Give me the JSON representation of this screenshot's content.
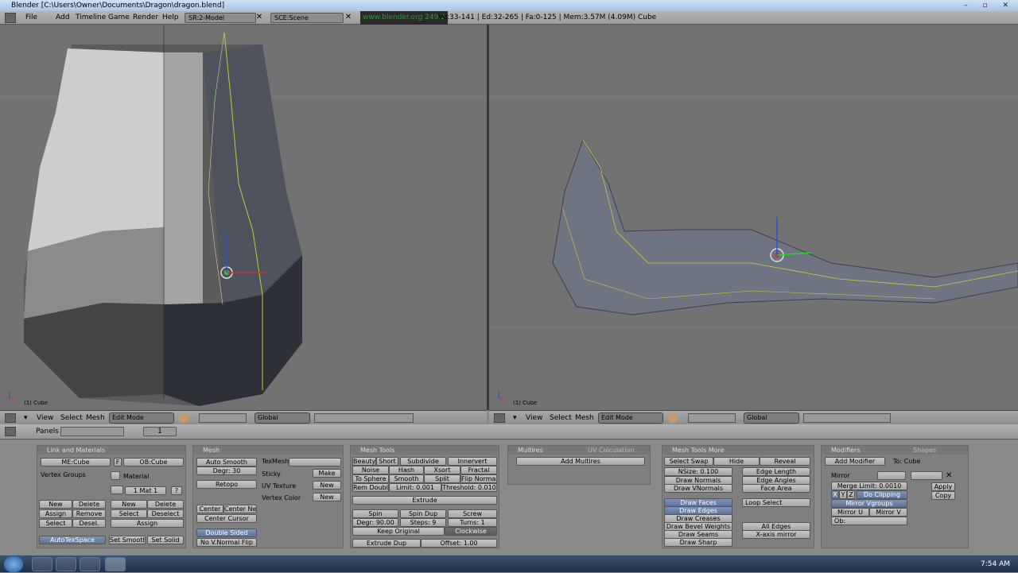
{
  "window": {
    "title": "Blender [C:\\Users\\Owner\\Documents\\Dragon\\dragon.blend]"
  },
  "menu": {
    "items": [
      "File",
      "Add",
      "Timeline",
      "Game",
      "Render",
      "Help"
    ],
    "screen": "SR:2-Model",
    "scene": "SCE:Scene",
    "url": "www.blender.org 249.2",
    "stats": "Ve:33-141 | Ed:32-265 | Fa:0-125 | Mem:3.57M (4.09M) Cube"
  },
  "viewport_left": {
    "label": "(1) Cube"
  },
  "viewport_right": {
    "label": "(1) Cube"
  },
  "header_left": {
    "view": "View",
    "select": "Select",
    "mesh": "Mesh",
    "mode": "Edit Mode",
    "orientation": "Global"
  },
  "header_right": {
    "view": "View",
    "select": "Select",
    "mesh": "Mesh",
    "mode": "Edit Mode",
    "orientation": "Global"
  },
  "buttons_header": {
    "panels": "Panels",
    "frame": "1"
  },
  "link_materials": {
    "title": "Link and Materials",
    "me": "ME:Cube",
    "f": "F",
    "ob": "OB:Cube",
    "vertex_groups": "Vertex Groups",
    "material": "Material",
    "mat": "1 Mat 1",
    "q": "?",
    "vg_new": "New",
    "vg_delete": "Delete",
    "vg_assign": "Assign",
    "vg_remove": "Remove",
    "vg_select": "Select",
    "vg_desel": "Desel.",
    "m_new": "New",
    "m_delete": "Delete",
    "m_select": "Select",
    "m_deselect": "Deselect",
    "m_assign": "Assign",
    "autotex": "AutoTexSpace",
    "set_smooth": "Set Smooth",
    "set_solid": "Set Solid"
  },
  "mesh": {
    "title": "Mesh",
    "auto_smooth": "Auto Smooth",
    "degr": "Degr: 30",
    "retopo": "Retopo",
    "texmesh": "TexMesh:",
    "sticky": "Sticky",
    "make": "Make",
    "uv_texture": "UV Texture",
    "new1": "New",
    "vertex_color": "Vertex Color",
    "new2": "New",
    "center": "Center",
    "center_new": "Center New",
    "center_cursor": "Center Cursor",
    "double_sided": "Double Sided",
    "no_v_normal_flip": "No V.Normal Flip"
  },
  "mesh_tools": {
    "title": "Mesh Tools",
    "beauty": "Beauty",
    "short": "Short",
    "subdivide": "Subdivide",
    "innervert": "Innervert",
    "noise": "Noise",
    "hash": "Hash",
    "xsort": "Xsort",
    "fractal": "Fractal",
    "to_sphere": "To Sphere",
    "smooth": "Smooth",
    "split": "Split",
    "flip_normal": "Flip Normal",
    "rem_doubl": "Rem Doubl",
    "limit": "Limit: 0.001",
    "threshold": "Threshold: 0.010",
    "extrude": "Extrude",
    "spin": "Spin",
    "spin_dup": "Spin Dup",
    "screw": "Screw",
    "degr": "Degr: 90.00",
    "steps": "Steps: 9",
    "turns": "Turns: 1",
    "keep_original": "Keep Original",
    "clockwise": "Clockwise",
    "extrude_dup": "Extrude Dup",
    "offset": "Offset: 1.00"
  },
  "multires": {
    "title": "Multires",
    "tab2": "UV Calculation",
    "add": "Add Multires"
  },
  "mesh_tools_more": {
    "title": "Mesh Tools More",
    "select_swap": "Select Swap",
    "hide": "Hide",
    "reveal": "Reveal",
    "nsize": "NSize: 0.100",
    "draw_normals": "Draw Normals",
    "draw_vnormals": "Draw VNormals",
    "edge_length": "Edge Length",
    "edge_angles": "Edge Angles",
    "face_area": "Face Area",
    "draw_faces": "Draw Faces",
    "draw_edges": "Draw Edges",
    "draw_creases": "Draw Creases",
    "draw_bevel": "Draw Bevel Weights",
    "draw_seams": "Draw Seams",
    "draw_sharp": "Draw Sharp",
    "loop_select": "Loop Select",
    "all_edges": "All Edges",
    "xaxis_mirror": "X-axis mirror"
  },
  "modifiers": {
    "title": "Modifiers",
    "tab2": "Shapes",
    "add": "Add Modifier",
    "to": "To: Cube",
    "mirror": "Mirror",
    "merge_limit": "Merge Limit: 0.0010",
    "x": "X",
    "y": "Y",
    "z": "Z",
    "do_clipping": "Do Clipping",
    "mirror_vgroups": "Mirror Vgroups",
    "mirror_u": "Mirror U",
    "mirror_v": "Mirror V",
    "ob": "Ob:",
    "apply": "Apply",
    "copy": "Copy"
  },
  "taskbar": {
    "clock": "7:54 AM"
  }
}
